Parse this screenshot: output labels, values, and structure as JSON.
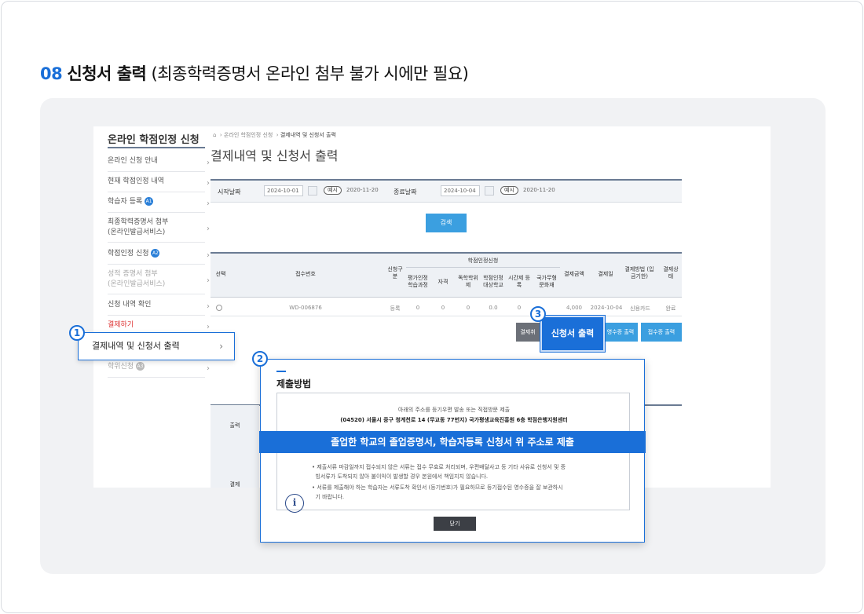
{
  "heading": {
    "step_num": "08",
    "strong": "신청서 출력",
    "light": "(최종학력증명서 온라인 첨부 불가 시에만 필요)"
  },
  "sidebar": {
    "title": "온라인 학점인정 신청",
    "items": [
      {
        "label": "온라인 신청 안내"
      },
      {
        "label": "현재 학점인정 내역"
      },
      {
        "label": "학습자 등록",
        "badge": "A1"
      },
      {
        "label": "최종학력증명서 첨부",
        "label2": "(온라인발급서비스)"
      },
      {
        "label": "학점인정 신청",
        "badge": "A2"
      },
      {
        "label": "성적 증명서 첨부",
        "label2": "(온라인발급서비스)"
      },
      {
        "label": "신청 내역 확인"
      },
      {
        "label": "결제하기"
      },
      {
        "label": "학위신청",
        "badge": "A3"
      }
    ]
  },
  "breadcrumb": {
    "home": "⌂",
    "level1": "온라인 학점인정 신청",
    "level2": "결제내역 및 신청서 출력"
  },
  "page_title": "결제내역 및 신청서 출력",
  "filter": {
    "start_label": "시작날짜",
    "start_value": "2024-10-01",
    "end_label": "종료날짜",
    "end_value": "2024-10-04",
    "example_pill": "예시",
    "example_text": "2020-11-20"
  },
  "search_label": "검색",
  "table": {
    "headers": {
      "select": "선택",
      "receipt_no": "접수번호",
      "apply_type": "신청구분",
      "group": "학점인정신청",
      "sub": [
        "평가인정 학습과정",
        "자격",
        "독학학위제",
        "학점인정 대상학교",
        "시간제 등록",
        "국가무형 문화재"
      ],
      "amount": "결제금액",
      "date": "결제일",
      "method": "결제방법 (입금기한)",
      "status": "결제상태"
    },
    "row": {
      "receipt_no": "WD-006876",
      "apply_type": "등록",
      "values": [
        "0",
        "0",
        "0",
        "0.0",
        "0"
      ],
      "amount": "4,000",
      "date": "2024-10-04",
      "method": "신용카드",
      "status": "완료"
    }
  },
  "buttons": {
    "gray": "결제취",
    "print": "신청서 출력",
    "receipt1": "영수증 출력",
    "receipt2": "접수증 출력",
    "lower_label": "출력",
    "lower_label2": "결제"
  },
  "callouts": {
    "step1": "1",
    "step2": "2",
    "step3": "3",
    "menu_item": "결제내역 및 신청서 출력",
    "chev": "›"
  },
  "modal": {
    "title": "제출방법",
    "addr_line1": "아래의 주소를 등기우편 발송 또는 직접방문 제출",
    "addr_line2": "(04520) 서울시 중구 청계천로 14 (무교동 77번지) 국가평생교육진흥원 6층 학점은행지원센터",
    "highlight": "졸업한 학교의 졸업증명서, 학습자등록 신청서 위 주소로 제출",
    "info_icon": "i",
    "note1_a": "제출서류 마감일까지 접수되지 않은 서류는 접수 무효로 처리되며, 우편배달사고 등 기타 사유로 신청서 및 증",
    "note1_b": "빙서류가 도착되지 않아 불이익이 발생할 경우 본원에서 책임지지 않습니다.",
    "note2_a": "서류를 제출해야 하는 학습자는 서류도착 확인서 (등기번호)가 필요하므로 등기접수된 영수증을 잘 보관하시",
    "note2_b": "기 바랍니다.",
    "close": "닫기"
  }
}
